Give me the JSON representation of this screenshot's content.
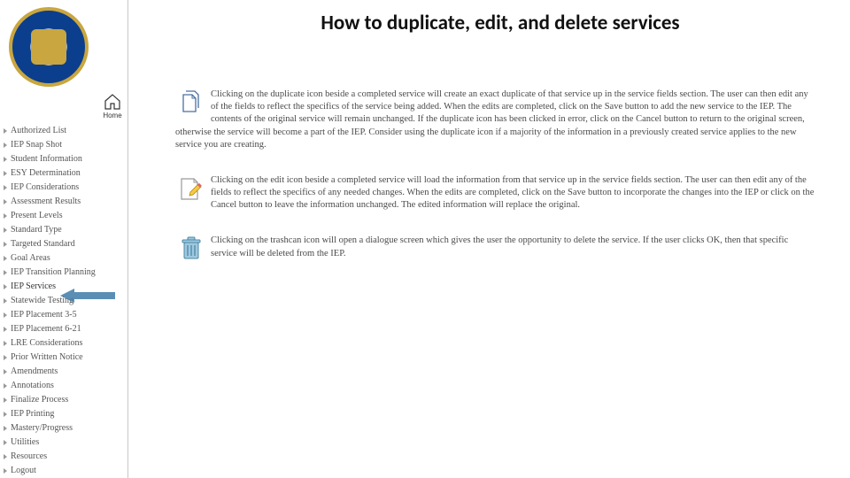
{
  "page_title": "How to duplicate, edit, and delete services",
  "home_label": "Home",
  "sidebar_items": [
    "Authorized List",
    "IEP Snap Shot",
    "Student Information",
    "ESY Determination",
    "IEP Considerations",
    "Assessment Results",
    "Present Levels",
    "Standard Type",
    "Targeted Standard",
    "Goal Areas",
    "IEP Transition Planning",
    "IEP Services",
    "Statewide Testing",
    "IEP Placement 3-5",
    "IEP Placement 6-21",
    "LRE Considerations",
    "Prior Written Notice",
    "Amendments",
    "Annotations",
    "Finalize Process",
    "IEP Printing",
    "Mastery/Progress",
    "Utilities",
    "Resources",
    "Logout"
  ],
  "highlighted_item_index": 11,
  "sections": {
    "duplicate": {
      "icon_name": "duplicate-icon",
      "text": "Clicking on the duplicate icon beside a completed service will create an exact duplicate of that service up in the service fields section. The user can then edit any of the fields to reflect the specifics of the service being added. When the edits are completed, click on the Save button to add the new service to the IEP. The contents of the original service will remain unchanged.\nIf the duplicate icon has been clicked in error, click on the Cancel button to return to the original screen, otherwise the service will become a part of the IEP. Consider using the duplicate icon if a majority of the information in a previously created service applies to the new service you are creating."
    },
    "edit": {
      "icon_name": "edit-icon",
      "text": "Clicking on the edit icon beside a completed service will load the information from that service up in the service fields section. The user can then edit any of the fields to reflect the specifics of any needed changes. When the edits are completed, click on the Save button to incorporate the changes into the IEP or click on the Cancel button to leave the information unchanged. The edited information will replace the original."
    },
    "delete": {
      "icon_name": "trash-icon",
      "text": "Clicking on the trashcan icon will open a dialogue screen which gives the user the opportunity to delete the service. If the user clicks OK, then that specific service will be deleted from the IEP."
    }
  }
}
